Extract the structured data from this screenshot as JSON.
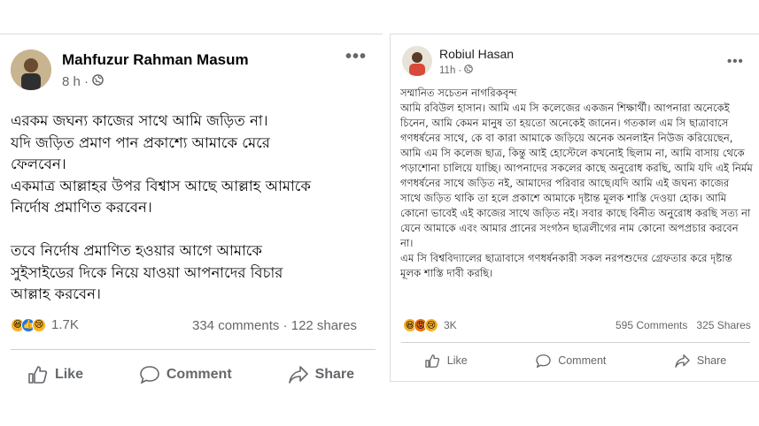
{
  "post1": {
    "author": "Mahfuzur Rahman Masum",
    "time": "8 h ·",
    "globe_icon": "globe-icon",
    "body": "এরকম জঘন্য কাজের সাথে আমি জড়িত না।\nযদি জড়িত প্রমাণ পান প্রকাশ্যে আমাকে মেরে\nফেলবেন।\nএকমাত্র আল্লাহর উপর বিশ্বাস আছে আল্লাহ আমাকে\nনির্দোষ প্রমাণিত করবেন।\n\nতবে নির্দোষ প্রমাণিত হওয়ার আগে আমাকে\nসুইসাইডের দিকে নিয়ে যাওয়া আপনাদের বিচার\nআল্লাহ করবেন।",
    "reaction_count": "1.7K",
    "comments": "334 comments",
    "shares": "122 shares",
    "actions": {
      "like": "Like",
      "comment": "Comment",
      "share": "Share"
    }
  },
  "post2": {
    "author": "Robiul Hasan",
    "time": "11h ·",
    "globe_icon": "globe-icon",
    "body": "সম্মানিত সচেতন নাগরিকবৃন্দ\nআমি রবিউল হাসান। আমি এম সি কলেজের একজন শিক্ষার্থী। আপনারা অনেকেই চিনেন, আমি কেমন মানুষ তা হয়তো অনেকেই জানেন। গতকাল এম সি ছাত্রাবাসে গণধর্ষনের সাথে, কে বা কারা আমাকে জড়িয়ে অনেক অনলাইন নিউজ করিয়েছেন, আমি এম সি কলেজ ছাত্র, কিন্তু আই হোস্টেলে কখনোই ছিলাম না, আমি বাসায় থেকে পড়াশোনা চালিয়ে যাচ্ছি। আপনাদের সকলের কাছে অনুরোধ করছি, আমি যদি এই নির্মম গণধর্ষনের সাথে জড়িত নই, আমাদের পরিবার আছে।যদি আমি এই জঘন্য কাজের সাথে জড়িত থাকি তা হলে প্রকাশে আমাকে দৃষ্টান্ত মূলক শাস্তি দেওয়া হোক। আমি কোনো ভাবেই এই কাজের সাথে জড়িত নই। সবার কাছে বিনীত অনুরোধ করছি সত্য না যেনে আমাকে এবং আমার প্রানের সংগঠন ছাত্রলীগের নাম কোনো অপপ্রচার করবেন না।\nএম সি বিশ্ববিদ্যালের ছাত্রাবাসে গণধর্ষনকারী সকল নরপশুদের গ্রেফতার করে দৃষ্টান্ত মূলক শাস্তি দাবী করছি।",
    "reaction_count": "3K",
    "comments": "595 Comments",
    "shares": "325 Shares",
    "actions": {
      "like": "Like",
      "comment": "Comment",
      "share": "Share"
    }
  },
  "colors": {
    "meta": "#65676b",
    "divider": "#ced0d4",
    "like_blue": "#1877f2",
    "reaction_yellow": "#f7b125"
  }
}
